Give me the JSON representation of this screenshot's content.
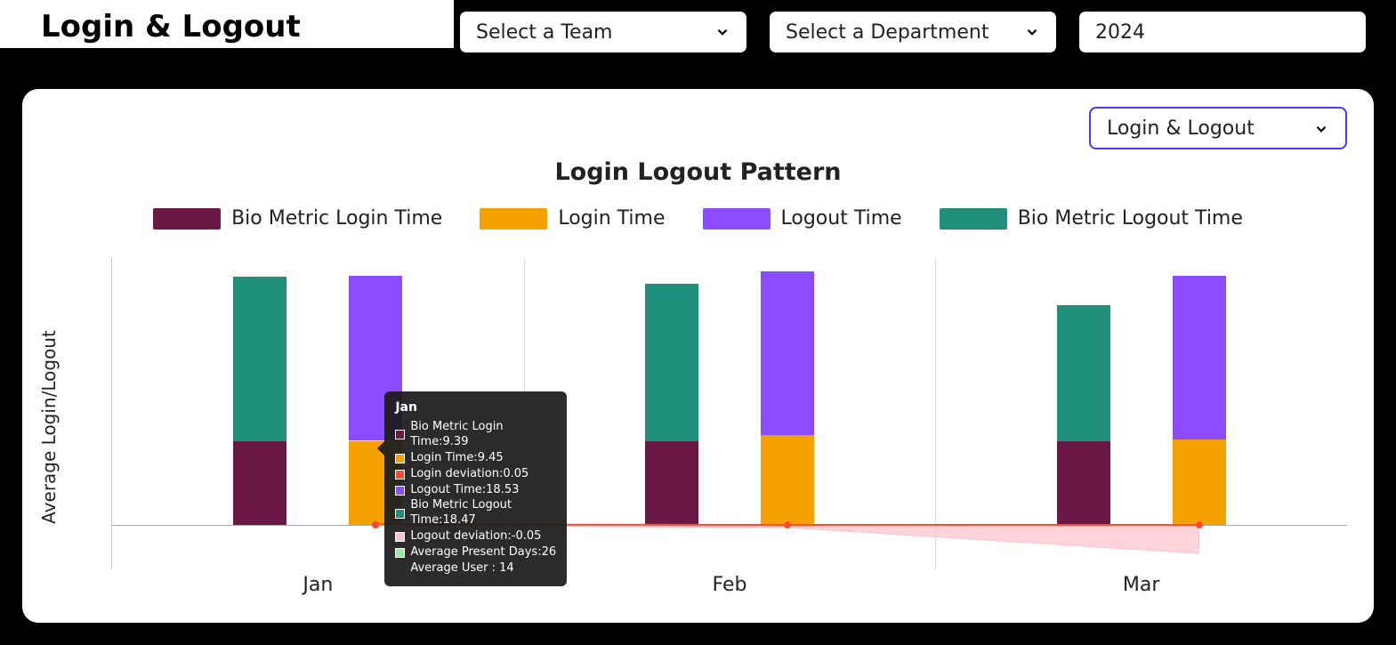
{
  "header": {
    "title": "Login & Logout",
    "team_placeholder": "Select a Team",
    "dept_placeholder": "Select a Department",
    "year_value": "2024"
  },
  "card": {
    "metric_select": "Login & Logout",
    "chart_title": "Login Logout Pattern",
    "yaxis_label": "Average Login/Logout"
  },
  "legend": {
    "bio_login": "Bio Metric Login Time",
    "login": "Login Time",
    "logout": "Logout Time",
    "bio_logout": "Bio Metric Logout Time"
  },
  "colors": {
    "bio_login": "#6b1847",
    "login": "#f5a100",
    "logout": "#8d4bff",
    "bio_logout": "#1f8f7c",
    "login_dev": "#ff4a2e",
    "logout_dev": "#ffc0cb",
    "present": "#9af09a"
  },
  "tooltip": {
    "month": "Jan",
    "rows": [
      {
        "color": "#6b1847",
        "label": "Bio Metric Login Time:9.39"
      },
      {
        "color": "#f5a100",
        "label": "Login Time:9.45"
      },
      {
        "color": "#ff4a2e",
        "label": "Login deviation:0.05"
      },
      {
        "color": "#8d4bff",
        "label": "Logout Time:18.53"
      },
      {
        "color": "#1f8f7c",
        "label": "Bio Metric Logout Time:18.47"
      },
      {
        "color": "#ffc0cb",
        "label": "Logout deviation:-0.05"
      },
      {
        "color": "#9af09a",
        "label": "Average Present Days:26"
      }
    ],
    "footer": "Average User : 14"
  },
  "chart_data": {
    "type": "bar",
    "title": "Login Logout Pattern",
    "xlabel": "",
    "ylabel": "Average Login/Logout",
    "ylim": [
      -5,
      30
    ],
    "yticks": [
      -5,
      0,
      5,
      10,
      15,
      20,
      25,
      30
    ],
    "categories": [
      "Jan",
      "Feb",
      "Mar"
    ],
    "series": [
      {
        "name": "Bio Metric Login Time",
        "color": "#6b1847",
        "values": [
          9.39,
          9.4,
          9.4
        ]
      },
      {
        "name": "Bio Metric Logout Time",
        "color": "#1f8f7c",
        "values": [
          18.47,
          17.7,
          15.3
        ]
      },
      {
        "name": "Login Time",
        "color": "#f5a100",
        "values": [
          9.45,
          10.1,
          9.6
        ]
      },
      {
        "name": "Logout Time",
        "color": "#8d4bff",
        "values": [
          18.53,
          18.4,
          18.4
        ]
      },
      {
        "name": "Login deviation",
        "color": "#ff4a2e",
        "values": [
          0.05,
          0.0,
          0.0
        ],
        "type": "line"
      },
      {
        "name": "Logout deviation",
        "color": "#ffc0cb",
        "values": [
          -0.05,
          -0.3,
          -3.2
        ],
        "type": "area"
      }
    ],
    "extra": {
      "Average Present Days": [
        26,
        null,
        null
      ],
      "Average User": [
        14,
        null,
        null
      ]
    },
    "stacking": {
      "group1": [
        "Bio Metric Login Time",
        "Bio Metric Logout Time"
      ],
      "group2": [
        "Login Time",
        "Logout Time"
      ]
    }
  }
}
